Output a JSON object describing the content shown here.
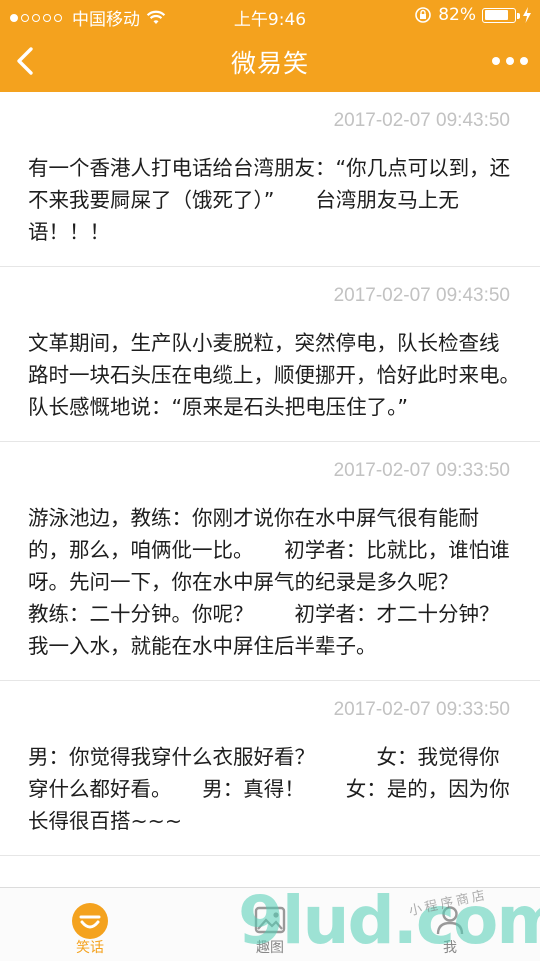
{
  "status_bar": {
    "carrier": "中国移动",
    "time": "上午9:46",
    "battery_percent": "82%",
    "battery_level": 0.82
  },
  "nav": {
    "title": "微易笑"
  },
  "posts": [
    {
      "time": "2017-02-07 09:43:50",
      "text": "有一个香港人打电话给台湾朋友：“你几点可以到，还不来我要屙屎了（饿死了）”　　台湾朋友马上无语！！！"
    },
    {
      "time": "2017-02-07 09:43:50",
      "text": "文革期间，生产队小麦脱粒，突然停电，队长检查线路时一块石头压在电缆上，顺便挪开，恰好此时来电。　　队长感慨地说：“原来是石头把电压住了。”"
    },
    {
      "time": "2017-02-07 09:33:50",
      "text": "游泳池边，教练：你刚才说你在水中屏气很有能耐的，那么，咱俩仳一比。　　初学者：比就比，谁怕谁呀。先问一下，你在水中屏气的纪录是多久呢？　　教练：二十分钟。你呢？　　初学者：才二十分钟？我一入水，就能在水中屏住后半辈子。"
    },
    {
      "time": "2017-02-07 09:33:50",
      "text": "男：你觉得我穿什么衣服好看？　　　女：我觉得你穿什么都好看。　　男：真得！　　女：是的，因为你长得很百搭~~~"
    }
  ],
  "tabs": [
    {
      "label": "笑话",
      "icon": "smile-icon",
      "active": true
    },
    {
      "label": "趣图",
      "icon": "picture-icon",
      "active": false
    },
    {
      "label": "我",
      "icon": "person-icon",
      "active": false
    }
  ],
  "watermark": {
    "main": "9lud.com",
    "small": "小程序商店"
  },
  "colors": {
    "accent": "#F4A21E",
    "time_text": "#C2C2C2",
    "body_text": "#1E1E1E"
  }
}
